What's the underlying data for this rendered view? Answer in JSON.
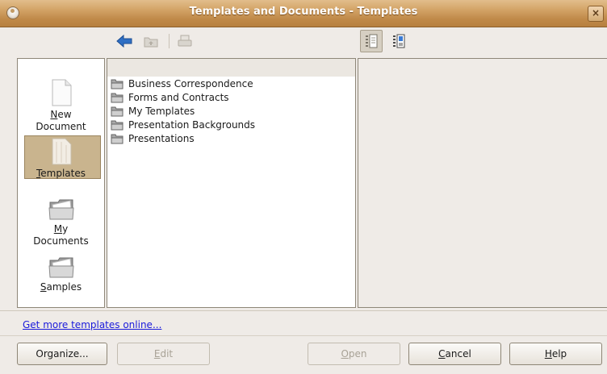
{
  "window": {
    "title": "Templates and Documents - Templates",
    "close_glyph": "×"
  },
  "toolbar": {
    "back_icon": "back-arrow-icon",
    "up_icon": "folder-up-icon",
    "print_icon": "print-icon",
    "view_details_icon": "view-details-icon",
    "view_preview_icon": "view-preview-icon"
  },
  "nav": {
    "new_document": {
      "line1_u": "N",
      "line1_rest": "ew",
      "line2": "Document"
    },
    "templates": {
      "u": "T",
      "rest": "emplates"
    },
    "my_documents": {
      "u": "M",
      "rest": "y",
      "line2": "Documents"
    },
    "samples": {
      "u": "S",
      "rest": "amples"
    }
  },
  "list": {
    "items": [
      "Business Correspondence",
      "Forms and Contracts",
      "My Templates",
      "Presentation Backgrounds",
      "Presentations"
    ]
  },
  "footer": {
    "link": "Get more templates online...",
    "organize": "Organize...",
    "edit_u": "E",
    "edit_rest": "dit",
    "open_u": "O",
    "open_rest": "pen",
    "cancel_u": "C",
    "cancel_rest": "ancel",
    "help_u": "H",
    "help_rest": "elp"
  },
  "colors": {
    "titlebar": "#c08a4a",
    "selection": "#c9b48e",
    "link": "#1a1adb"
  }
}
